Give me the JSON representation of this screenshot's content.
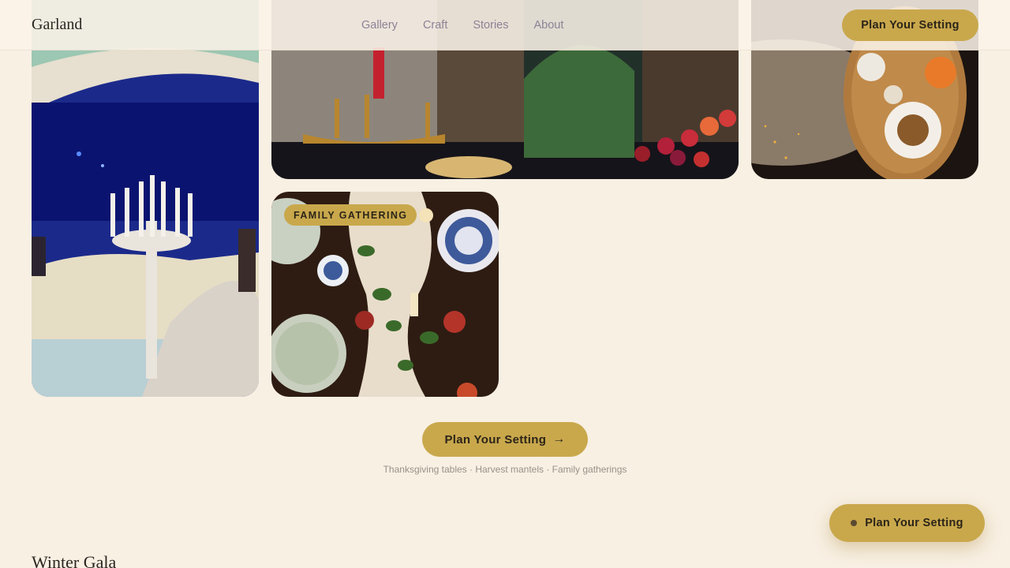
{
  "header": {
    "logo": "Garland",
    "nav": [
      "Gallery",
      "Craft",
      "Stories",
      "About"
    ],
    "cta_label": "Plan Your Setting"
  },
  "gallery": {
    "tiles": [
      {
        "name": "hall-candelabra"
      },
      {
        "name": "candles-and-fruit"
      },
      {
        "name": "coffee-tray"
      },
      {
        "name": "family-gathering",
        "badge": "FAMILY GATHERING"
      }
    ]
  },
  "cta": {
    "label": "Plan Your Setting",
    "arrow": "→",
    "subtitle": "Thanksgiving tables · Harvest mantels · Family gatherings"
  },
  "floating_button": {
    "label": "Plan Your Setting"
  },
  "next_section": {
    "title": "Winter Gala"
  },
  "colors": {
    "accent": "#c9a84c",
    "background": "#f8f0e3",
    "nav": "#8c8297"
  }
}
